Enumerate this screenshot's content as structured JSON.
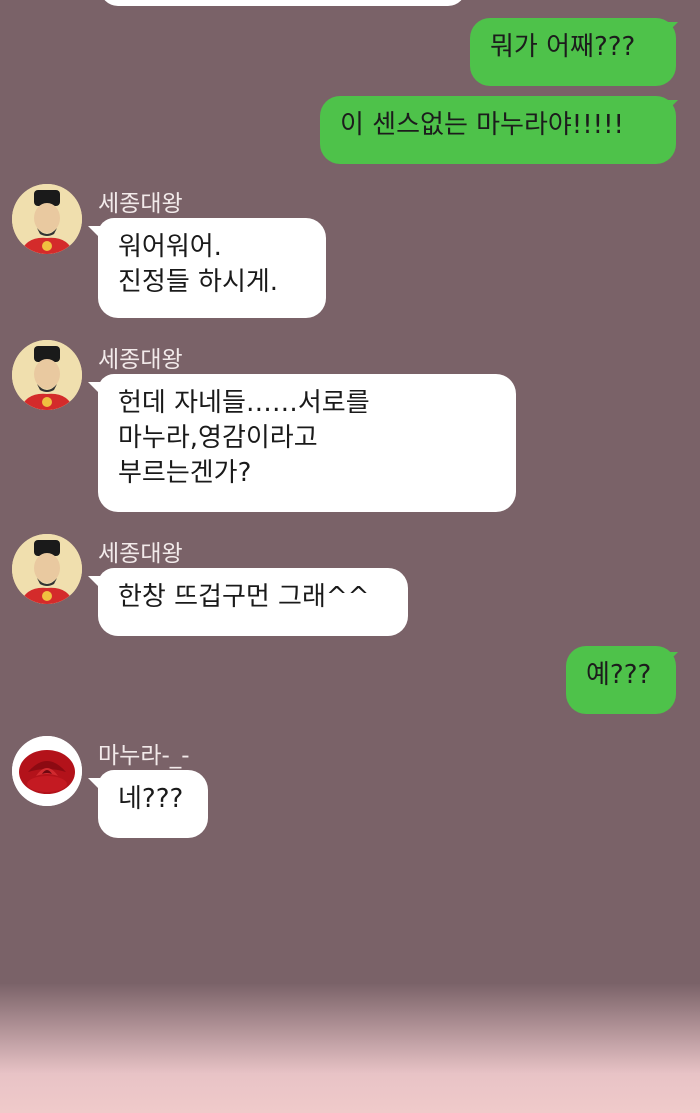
{
  "colors": {
    "background": "#7a6268",
    "incoming_bubble": "#ffffff",
    "outgoing_bubble": "#4ec24a",
    "name_text": "#f2eaea"
  },
  "messages": [
    {
      "from": "me",
      "text": "뭐가 어째???"
    },
    {
      "from": "me",
      "text": "이 센스없는 마누라야!!!!!"
    },
    {
      "from": "세종대왕",
      "avatar": "king-portrait-icon",
      "text": "워어워어.\n진정들 하시게."
    },
    {
      "from": "세종대왕",
      "avatar": "king-portrait-icon",
      "text": "헌데 자네들……서로를\n마누라,영감이라고\n부르는겐가?"
    },
    {
      "from": "세종대왕",
      "avatar": "king-portrait-icon",
      "text": "한창 뜨겁구먼 그래^^"
    },
    {
      "from": "me",
      "text": "예???"
    },
    {
      "from": "마누라-_-",
      "avatar": "red-rose-icon",
      "text": "네???"
    }
  ],
  "senders": {
    "king": "세종대왕",
    "wife": "마누라-_-"
  }
}
